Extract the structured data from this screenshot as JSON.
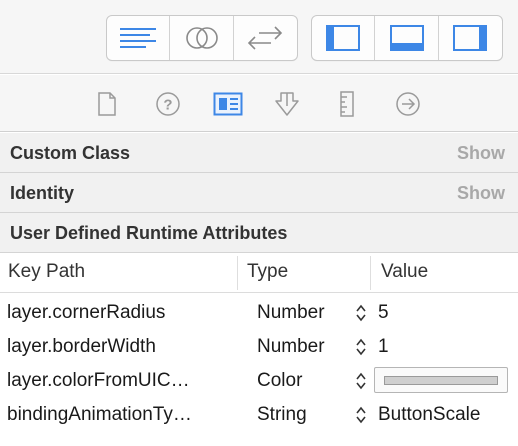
{
  "toolbar": {
    "left_group": [
      {
        "icon": "align-left-lines-icon",
        "active": true
      },
      {
        "icon": "overlapping-circles-icon",
        "active": false
      },
      {
        "icon": "swap-arrows-icon",
        "active": false
      }
    ],
    "right_group": [
      {
        "icon": "left-panel-icon"
      },
      {
        "icon": "bottom-panel-icon"
      },
      {
        "icon": "right-panel-icon"
      }
    ],
    "accent_color": "#3d87e6"
  },
  "inspector_tabs": [
    {
      "icon": "file-inspector-icon",
      "active": false
    },
    {
      "icon": "quick-help-icon",
      "active": false
    },
    {
      "icon": "identity-inspector-icon",
      "active": true
    },
    {
      "icon": "attributes-inspector-icon",
      "active": false
    },
    {
      "icon": "size-inspector-icon",
      "active": false
    },
    {
      "icon": "connections-inspector-icon",
      "active": false
    }
  ],
  "sections": {
    "custom_class": {
      "title": "Custom Class",
      "action": "Show"
    },
    "identity": {
      "title": "Identity",
      "action": "Show"
    },
    "runtime_attributes": {
      "title": "User Defined Runtime Attributes"
    }
  },
  "table": {
    "headers": {
      "key_path": "Key Path",
      "type": "Type",
      "value": "Value"
    },
    "rows": [
      {
        "key_path": "layer.cornerRadius",
        "type": "Number",
        "value": "5"
      },
      {
        "key_path": "layer.borderWidth",
        "type": "Number",
        "value": "1"
      },
      {
        "key_path": "layer.colorFromUIC…",
        "type": "Color",
        "value": "",
        "value_color": "#cfcfcf"
      },
      {
        "key_path": "bindingAnimationTy…",
        "type": "String",
        "value": "ButtonScale"
      }
    ]
  }
}
